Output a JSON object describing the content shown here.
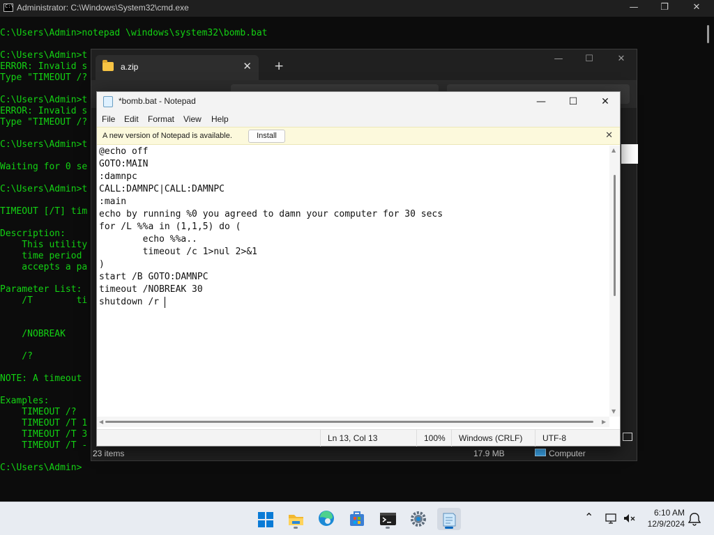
{
  "cmd": {
    "title": "Administrator: C:\\Windows\\System32\\cmd.exe",
    "controls": {
      "minimize": "—",
      "maximize": "❐",
      "close": "✕"
    },
    "lines": [
      "C:\\Users\\Admin>notepad \\windows\\system32\\bomb.bat",
      "",
      "C:\\Users\\Admin>t",
      "ERROR: Invalid s",
      "Type \"TIMEOUT /?",
      "",
      "C:\\Users\\Admin>t",
      "ERROR: Invalid s",
      "Type \"TIMEOUT /?",
      "",
      "C:\\Users\\Admin>t",
      "",
      "Waiting for 0 se",
      "",
      "C:\\Users\\Admin>t",
      "",
      "TIMEOUT [/T] tim",
      "",
      "Description:",
      "    This utility",
      "    time period",
      "    accepts a pa",
      "",
      "Parameter List:",
      "    /T        ti",
      "",
      "",
      "    /NOBREAK",
      "",
      "    /?",
      "",
      "NOTE: A timeout",
      "",
      "Examples:",
      "    TIMEOUT /?",
      "    TIMEOUT /T 1",
      "    TIMEOUT /T 3",
      "    TIMEOUT /T -",
      "",
      "C:\\Users\\Admin>"
    ]
  },
  "explorer": {
    "tab_title": "a.zip",
    "tab_close": "✕",
    "new_tab": "+",
    "controls": {
      "minimize": "—",
      "maximize": "☐",
      "close": "✕"
    },
    "status_items": "23 items",
    "status_size": "17.9 MB",
    "status_location": "Computer"
  },
  "notepad": {
    "title": "*bomb.bat - Notepad",
    "controls": {
      "minimize": "—",
      "maximize": "☐",
      "close": "✕"
    },
    "menu": [
      "File",
      "Edit",
      "Format",
      "View",
      "Help"
    ],
    "infobar": {
      "message": "A new version of Notepad is available.",
      "button": "Install",
      "close": "✕"
    },
    "content_lines": [
      "@echo off",
      "GOTO:MAIN",
      ":damnpc",
      "CALL:DAMNPC|CALL:DAMNPC",
      ":main",
      "echo by running %0 you agreed to damn your computer for 30 secs",
      "for /L %%a in (1,1,5) do (",
      "        echo %%a..",
      "        timeout /c 1>nul 2>&1",
      ")",
      "start /B GOTO:DAMNPC",
      "timeout /NOBREAK 30",
      "shutdown /r "
    ],
    "status": {
      "position": "Ln 13, Col 13",
      "zoom": "100%",
      "line_ending": "Windows (CRLF)",
      "encoding": "UTF-8"
    }
  },
  "taskbar": {
    "apps": [
      "start-icon",
      "file-explorer-icon",
      "edge-icon",
      "store-icon",
      "terminal-icon",
      "settings-icon",
      "notepad-icon"
    ],
    "tray": {
      "chevron": "⌃",
      "time": "6:10 AM",
      "date": "12/9/2024"
    }
  }
}
